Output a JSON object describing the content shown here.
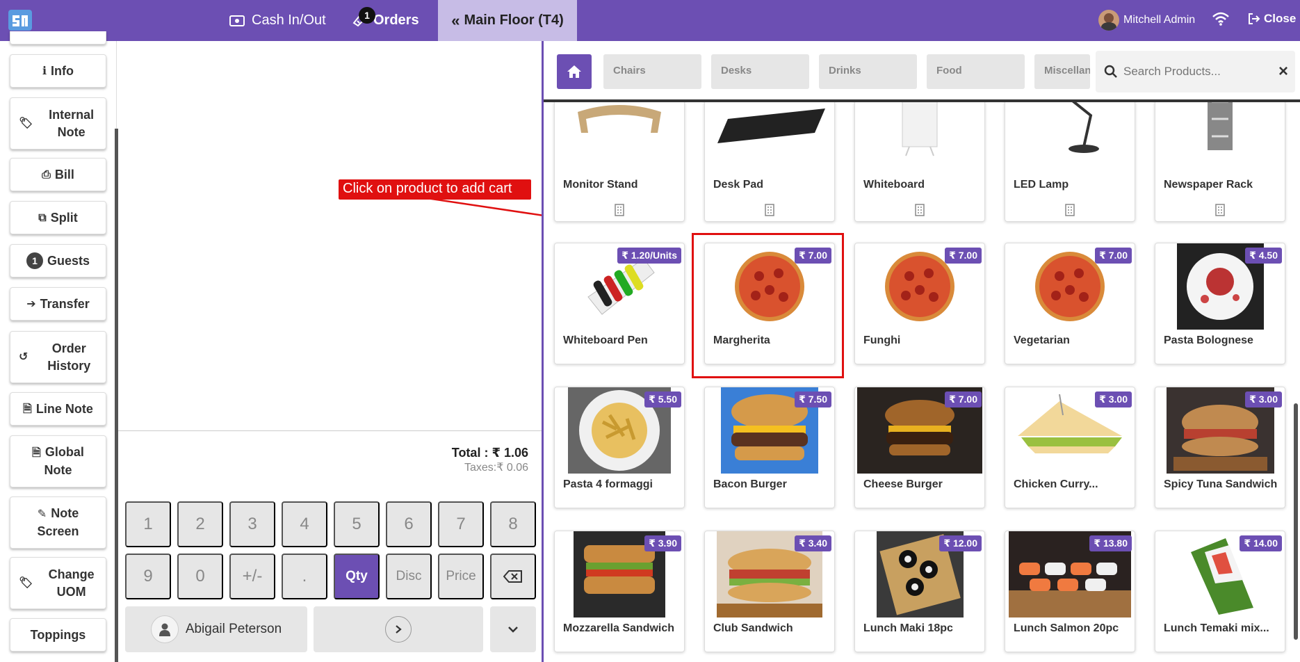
{
  "colors": {
    "brand": "#6c4fb3",
    "active_tab_bg": "#c7bce6",
    "annotation": "#e01010"
  },
  "topbar": {
    "cash_label": "Cash In/Out",
    "orders_label": "Orders",
    "orders_badge": "1",
    "floor_label": "Main Floor (T4)",
    "user_name": "Mitchell Admin",
    "close_label": "Close"
  },
  "sidebar": {
    "info": "Info",
    "internal_note": "Internal Note",
    "bill": "Bill",
    "split": "Split",
    "guests": "Guests",
    "guests_count": "1",
    "transfer": "Transfer",
    "order_history": "Order History",
    "line_note": "Line Note",
    "global_note": "Global Note",
    "note_screen": "Note Screen",
    "change_uom": "Change UOM",
    "toppings": "Toppings"
  },
  "order": {
    "total": "Total : ₹ 1.06",
    "taxes": "Taxes:₹ 0.06",
    "annotation": "Click on product to add cart"
  },
  "numpad": {
    "keys": [
      "1",
      "2",
      "3",
      "4",
      "5",
      "6",
      "7",
      "8",
      "9",
      "0",
      "+/-",
      ".",
      "Qty",
      "Disc",
      "Price"
    ],
    "customer": "Abigail Peterson"
  },
  "categories": [
    "Chairs",
    "Desks",
    "Drinks",
    "Food",
    "Miscellaneous"
  ],
  "search": {
    "placeholder": "Search Products..."
  },
  "products": [
    {
      "name": "Monitor Stand",
      "price": ""
    },
    {
      "name": "Desk Pad",
      "price": ""
    },
    {
      "name": "Whiteboard",
      "price": ""
    },
    {
      "name": "LED Lamp",
      "price": ""
    },
    {
      "name": "Newspaper Rack",
      "price": ""
    },
    {
      "name": "Whiteboard Pen",
      "price": "₹ 1.20/Units"
    },
    {
      "name": "Margherita",
      "price": "₹ 7.00"
    },
    {
      "name": "Funghi",
      "price": "₹ 7.00"
    },
    {
      "name": "Vegetarian",
      "price": "₹ 7.00"
    },
    {
      "name": "Pasta Bolognese",
      "price": "₹ 4.50"
    },
    {
      "name": "Pasta 4 formaggi",
      "price": "₹ 5.50"
    },
    {
      "name": "Bacon Burger",
      "price": "₹ 7.50"
    },
    {
      "name": "Cheese Burger",
      "price": "₹ 7.00"
    },
    {
      "name": "Chicken Curry...",
      "price": "₹ 3.00"
    },
    {
      "name": "Spicy Tuna Sandwich",
      "price": "₹ 3.00"
    },
    {
      "name": "Mozzarella Sandwich",
      "price": "₹ 3.90"
    },
    {
      "name": "Club Sandwich",
      "price": "₹ 3.40"
    },
    {
      "name": "Lunch Maki 18pc",
      "price": "₹ 12.00"
    },
    {
      "name": "Lunch Salmon 20pc",
      "price": "₹ 13.80"
    },
    {
      "name": "Lunch Temaki mix...",
      "price": "₹ 14.00"
    }
  ]
}
